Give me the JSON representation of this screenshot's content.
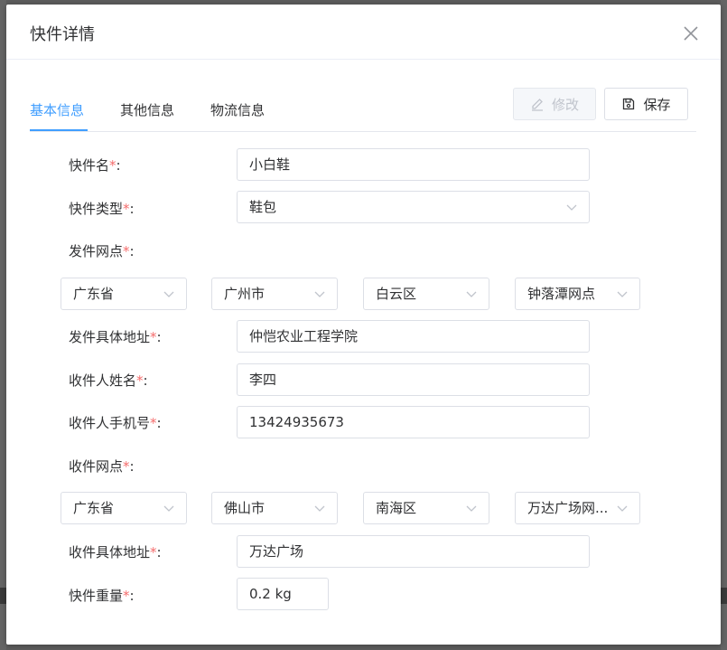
{
  "dialog": {
    "title": "快件详情"
  },
  "tabs": [
    {
      "label": "基本信息",
      "active": true
    },
    {
      "label": "其他信息",
      "active": false
    },
    {
      "label": "物流信息",
      "active": false
    }
  ],
  "toolbar": {
    "edit_label": "修改",
    "save_label": "保存"
  },
  "form": {
    "required_mark": "*",
    "colon": ":",
    "name": {
      "label": "快件名",
      "value": "小白鞋"
    },
    "type": {
      "label": "快件类型",
      "value": "鞋包"
    },
    "send_point": {
      "label": "发件网点",
      "province": "广东省",
      "city": "广州市",
      "district": "白云区",
      "point": "钟落潭网点"
    },
    "send_address": {
      "label": "发件具体地址",
      "value": "仲恺农业工程学院"
    },
    "receiver_name": {
      "label": "收件人姓名",
      "value": "李四"
    },
    "receiver_phone": {
      "label": "收件人手机号",
      "value": "13424935673"
    },
    "receive_point": {
      "label": "收件网点",
      "province": "广东省",
      "city": "佛山市",
      "district": "南海区",
      "point": "万达广场网..."
    },
    "receive_address": {
      "label": "收件具体地址",
      "value": "万达广场"
    },
    "weight": {
      "label": "快件重量",
      "value": "0.2 kg"
    }
  },
  "colors": {
    "accent": "#409eff",
    "required": "#f56c6c",
    "border": "#dcdfe6"
  },
  "icons": {
    "close": "close-icon",
    "edit": "pencil-icon",
    "save": "save-icon",
    "dropdown": "chevron-down-icon"
  }
}
